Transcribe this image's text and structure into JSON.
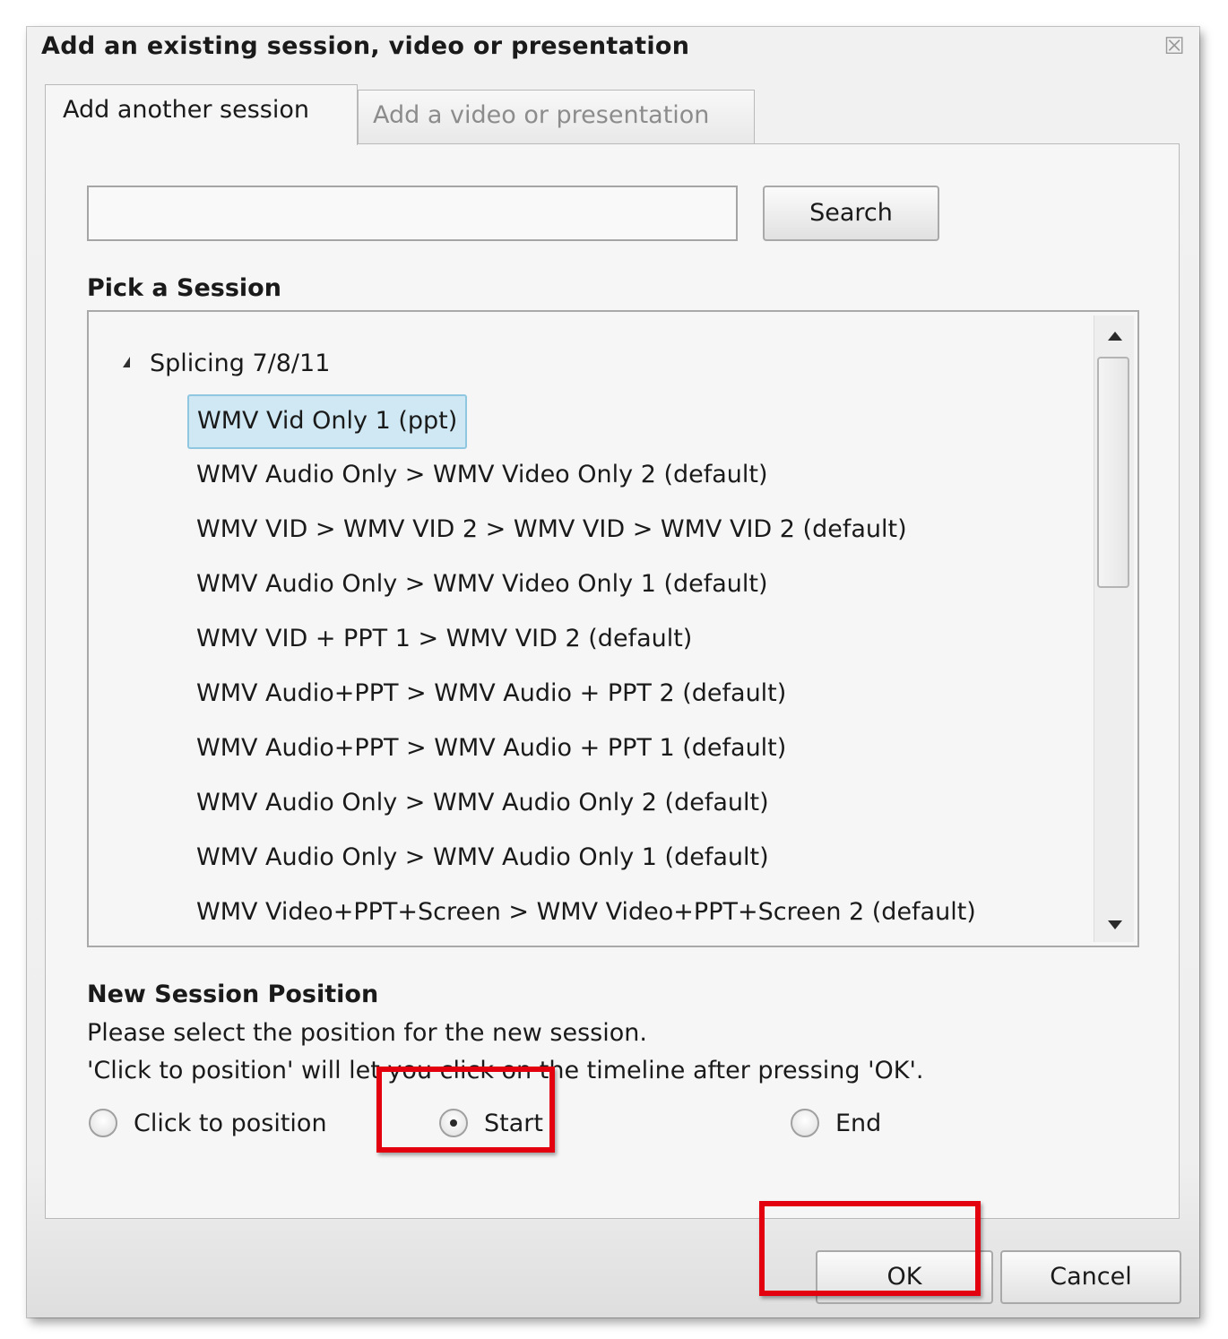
{
  "dialog": {
    "title": "Add an existing session, video or presentation",
    "close_icon": "close-icon"
  },
  "tabs": [
    {
      "label": "Add another session",
      "active": true
    },
    {
      "label": "Add a video or presentation",
      "active": false
    }
  ],
  "search": {
    "value": "",
    "button_label": "Search"
  },
  "session_picker": {
    "heading": "Pick a Session",
    "group_label": "Splicing 7/8/11",
    "group_expanded": true,
    "items": [
      {
        "label": "WMV Vid Only 1 (ppt)",
        "selected": true
      },
      {
        "label": "WMV Audio Only > WMV Video Only 2 (default)",
        "selected": false
      },
      {
        "label": "WMV VID > WMV VID 2 > WMV VID > WMV VID 2 (default)",
        "selected": false
      },
      {
        "label": "WMV Audio Only > WMV Video Only 1 (default)",
        "selected": false
      },
      {
        "label": "WMV VID + PPT 1 > WMV VID 2 (default)",
        "selected": false
      },
      {
        "label": "WMV Audio+PPT > WMV Audio + PPT 2 (default)",
        "selected": false
      },
      {
        "label": "WMV Audio+PPT > WMV Audio + PPT 1 (default)",
        "selected": false
      },
      {
        "label": "WMV Audio Only > WMV Audio Only 2 (default)",
        "selected": false
      },
      {
        "label": "WMV Audio Only > WMV Audio Only 1 (default)",
        "selected": false
      },
      {
        "label": "WMV Video+PPT+Screen > WMV Video+PPT+Screen 2 (default)",
        "selected": false
      }
    ]
  },
  "position": {
    "heading": "New Session Position",
    "help_line_1": "Please select the position for the new session.",
    "help_line_2": "'Click to position' will let you click on the timeline after pressing 'OK'.",
    "options": [
      {
        "label": "Click to position",
        "checked": false
      },
      {
        "label": "Start",
        "checked": true
      },
      {
        "label": "End",
        "checked": false
      }
    ]
  },
  "buttons": {
    "ok_label": "OK",
    "cancel_label": "Cancel"
  },
  "colors": {
    "selection_bg": "#cfe8f3",
    "highlight_annotation": "#e3000f"
  }
}
